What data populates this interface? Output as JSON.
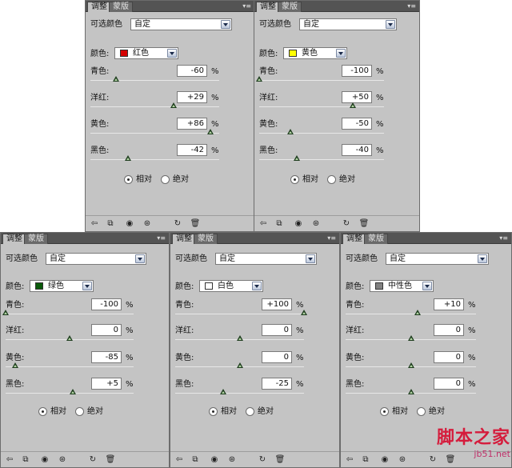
{
  "panels": [
    {
      "tabs": [
        "调整",
        "蒙版"
      ],
      "preset_label": "可选颜色",
      "preset_value": "自定",
      "color_label": "颜色:",
      "color_value": "红色",
      "swatch_color": "#d40000",
      "sliders": [
        {
          "label": "青色:",
          "value": "-60",
          "unit": "%",
          "level": 0.2
        },
        {
          "label": "洋红:",
          "value": "+29",
          "unit": "%",
          "level": 0.645
        },
        {
          "label": "黄色:",
          "value": "+86",
          "unit": "%",
          "level": 0.93
        },
        {
          "label": "黑色:",
          "value": "-42",
          "unit": "%",
          "level": 0.29
        }
      ],
      "method_relative": "相对",
      "method_absolute": "绝对",
      "method_selected": "relative"
    },
    {
      "tabs": [
        "调整",
        "蒙版"
      ],
      "preset_label": "可选颜色",
      "preset_value": "自定",
      "color_label": "颜色:",
      "color_value": "黄色",
      "swatch_color": "#ffff00",
      "sliders": [
        {
          "label": "青色:",
          "value": "-100",
          "unit": "%",
          "level": 0.0
        },
        {
          "label": "洋红:",
          "value": "+50",
          "unit": "%",
          "level": 0.75
        },
        {
          "label": "黄色:",
          "value": "-50",
          "unit": "%",
          "level": 0.25
        },
        {
          "label": "黑色:",
          "value": "-40",
          "unit": "%",
          "level": 0.3
        }
      ],
      "method_relative": "相对",
      "method_absolute": "绝对",
      "method_selected": "relative"
    },
    {
      "tabs": [
        "调整",
        "蒙版"
      ],
      "preset_label": "可选颜色",
      "preset_value": "自定",
      "color_label": "颜色:",
      "color_value": "绿色",
      "swatch_color": "#0a5a0a",
      "sliders": [
        {
          "label": "青色:",
          "value": "-100",
          "unit": "%",
          "level": 0.0
        },
        {
          "label": "洋红:",
          "value": "0",
          "unit": "%",
          "level": 0.5
        },
        {
          "label": "黄色:",
          "value": "-85",
          "unit": "%",
          "level": 0.075
        },
        {
          "label": "黑色:",
          "value": "+5",
          "unit": "%",
          "level": 0.525
        }
      ],
      "method_relative": "相对",
      "method_absolute": "绝对",
      "method_selected": "relative"
    },
    {
      "tabs": [
        "调整",
        "蒙版"
      ],
      "preset_label": "可选颜色",
      "preset_value": "自定",
      "color_label": "颜色:",
      "color_value": "白色",
      "swatch_color": "#ffffff",
      "sliders": [
        {
          "label": "青色:",
          "value": "+100",
          "unit": "%",
          "level": 1.0
        },
        {
          "label": "洋红:",
          "value": "0",
          "unit": "%",
          "level": 0.5
        },
        {
          "label": "黄色:",
          "value": "0",
          "unit": "%",
          "level": 0.5
        },
        {
          "label": "黑色:",
          "value": "-25",
          "unit": "%",
          "level": 0.375
        }
      ],
      "method_relative": "相对",
      "method_absolute": "绝对",
      "method_selected": "relative"
    },
    {
      "tabs": [
        "调整",
        "蒙版"
      ],
      "preset_label": "可选颜色",
      "preset_value": "自定",
      "color_label": "颜色:",
      "color_value": "中性色",
      "swatch_color": "#808080",
      "sliders": [
        {
          "label": "青色:",
          "value": "+10",
          "unit": "%",
          "level": 0.55
        },
        {
          "label": "洋红:",
          "value": "0",
          "unit": "%",
          "level": 0.5
        },
        {
          "label": "黄色:",
          "value": "0",
          "unit": "%",
          "level": 0.5
        },
        {
          "label": "黑色:",
          "value": "0",
          "unit": "%",
          "level": 0.5
        }
      ],
      "method_relative": "相对",
      "method_absolute": "绝对",
      "method_selected": "relative"
    }
  ],
  "footer_icons": [
    "back-arrow-icon",
    "clip-to-layer-icon",
    "layer-visibility-eye-icon",
    "view-previous-icon",
    "reset-icon",
    "delete-icon"
  ],
  "watermark": {
    "main": "脚本之家",
    "sub": "jb51.net"
  }
}
